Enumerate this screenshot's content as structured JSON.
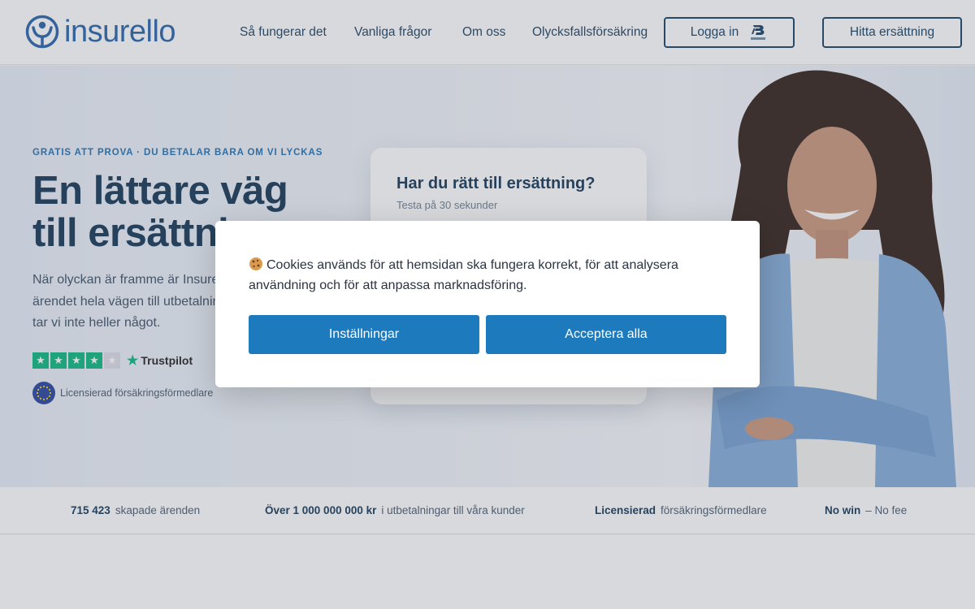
{
  "header": {
    "logo_text": "insurello",
    "nav": [
      "Så fungerar det",
      "Vanliga frågor",
      "Om oss",
      "Olycksfallsförsäkring"
    ],
    "login_label": "Logga in",
    "find_label": "Hitta ersättning",
    "bankid_icon": "bankid-icon"
  },
  "hero": {
    "eyebrow": "GRATIS ATT PROVA · DU BETALAR BARA OM VI LYCKAS",
    "headline_line1": "En lättare väg",
    "headline_line2": "till ersättning",
    "lead": "När olyckan är framme är Insurello här. Vi styr upp ärendet hela vägen till utbetalning – och får du inget tar vi inte heller något.",
    "rating_stars": 4,
    "rating_max": 5,
    "trustpilot_label": "Trustpilot",
    "licensed_label": "Licensierad försäkringsförmedlare"
  },
  "quiz": {
    "title": "Har du rätt till ersättning?",
    "subtitle": "Testa på 30 sekunder"
  },
  "stats": [
    {
      "bold": "715 423",
      "text": "skapade ärenden"
    },
    {
      "bold": "Över 1 000 000 000 kr",
      "text": "i utbetalningar till våra kunder"
    },
    {
      "bold": "Licensierad",
      "text": "försäkringsförmedlare"
    },
    {
      "bold": "No win",
      "text": "– No fee"
    }
  ],
  "cookie": {
    "message": "Cookies används för att hemsidan ska fungera korrekt, för att analysera användning och för att anpassa marknadsföring.",
    "settings_label": "Inställningar",
    "accept_label": "Acceptera alla"
  },
  "colors": {
    "brand": "#1f5ea8",
    "navy": "#0b2f50",
    "button_blue": "#1d7bbd",
    "trustpilot_green": "#00b67a"
  }
}
